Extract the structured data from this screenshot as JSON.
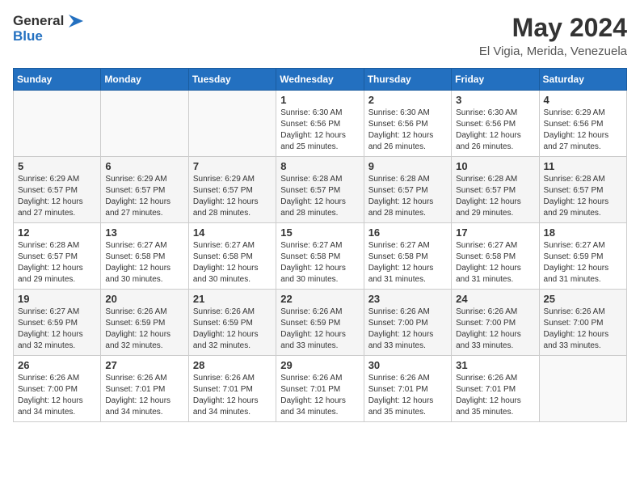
{
  "header": {
    "logo_line1": "General",
    "logo_line2": "Blue",
    "month_title": "May 2024",
    "subtitle": "El Vigia, Merida, Venezuela"
  },
  "days_of_week": [
    "Sunday",
    "Monday",
    "Tuesday",
    "Wednesday",
    "Thursday",
    "Friday",
    "Saturday"
  ],
  "weeks": [
    [
      {
        "num": "",
        "info": ""
      },
      {
        "num": "",
        "info": ""
      },
      {
        "num": "",
        "info": ""
      },
      {
        "num": "1",
        "info": "Sunrise: 6:30 AM\nSunset: 6:56 PM\nDaylight: 12 hours\nand 25 minutes."
      },
      {
        "num": "2",
        "info": "Sunrise: 6:30 AM\nSunset: 6:56 PM\nDaylight: 12 hours\nand 26 minutes."
      },
      {
        "num": "3",
        "info": "Sunrise: 6:30 AM\nSunset: 6:56 PM\nDaylight: 12 hours\nand 26 minutes."
      },
      {
        "num": "4",
        "info": "Sunrise: 6:29 AM\nSunset: 6:56 PM\nDaylight: 12 hours\nand 27 minutes."
      }
    ],
    [
      {
        "num": "5",
        "info": "Sunrise: 6:29 AM\nSunset: 6:57 PM\nDaylight: 12 hours\nand 27 minutes."
      },
      {
        "num": "6",
        "info": "Sunrise: 6:29 AM\nSunset: 6:57 PM\nDaylight: 12 hours\nand 27 minutes."
      },
      {
        "num": "7",
        "info": "Sunrise: 6:29 AM\nSunset: 6:57 PM\nDaylight: 12 hours\nand 28 minutes."
      },
      {
        "num": "8",
        "info": "Sunrise: 6:28 AM\nSunset: 6:57 PM\nDaylight: 12 hours\nand 28 minutes."
      },
      {
        "num": "9",
        "info": "Sunrise: 6:28 AM\nSunset: 6:57 PM\nDaylight: 12 hours\nand 28 minutes."
      },
      {
        "num": "10",
        "info": "Sunrise: 6:28 AM\nSunset: 6:57 PM\nDaylight: 12 hours\nand 29 minutes."
      },
      {
        "num": "11",
        "info": "Sunrise: 6:28 AM\nSunset: 6:57 PM\nDaylight: 12 hours\nand 29 minutes."
      }
    ],
    [
      {
        "num": "12",
        "info": "Sunrise: 6:28 AM\nSunset: 6:57 PM\nDaylight: 12 hours\nand 29 minutes."
      },
      {
        "num": "13",
        "info": "Sunrise: 6:27 AM\nSunset: 6:58 PM\nDaylight: 12 hours\nand 30 minutes."
      },
      {
        "num": "14",
        "info": "Sunrise: 6:27 AM\nSunset: 6:58 PM\nDaylight: 12 hours\nand 30 minutes."
      },
      {
        "num": "15",
        "info": "Sunrise: 6:27 AM\nSunset: 6:58 PM\nDaylight: 12 hours\nand 30 minutes."
      },
      {
        "num": "16",
        "info": "Sunrise: 6:27 AM\nSunset: 6:58 PM\nDaylight: 12 hours\nand 31 minutes."
      },
      {
        "num": "17",
        "info": "Sunrise: 6:27 AM\nSunset: 6:58 PM\nDaylight: 12 hours\nand 31 minutes."
      },
      {
        "num": "18",
        "info": "Sunrise: 6:27 AM\nSunset: 6:59 PM\nDaylight: 12 hours\nand 31 minutes."
      }
    ],
    [
      {
        "num": "19",
        "info": "Sunrise: 6:27 AM\nSunset: 6:59 PM\nDaylight: 12 hours\nand 32 minutes."
      },
      {
        "num": "20",
        "info": "Sunrise: 6:26 AM\nSunset: 6:59 PM\nDaylight: 12 hours\nand 32 minutes."
      },
      {
        "num": "21",
        "info": "Sunrise: 6:26 AM\nSunset: 6:59 PM\nDaylight: 12 hours\nand 32 minutes."
      },
      {
        "num": "22",
        "info": "Sunrise: 6:26 AM\nSunset: 6:59 PM\nDaylight: 12 hours\nand 33 minutes."
      },
      {
        "num": "23",
        "info": "Sunrise: 6:26 AM\nSunset: 7:00 PM\nDaylight: 12 hours\nand 33 minutes."
      },
      {
        "num": "24",
        "info": "Sunrise: 6:26 AM\nSunset: 7:00 PM\nDaylight: 12 hours\nand 33 minutes."
      },
      {
        "num": "25",
        "info": "Sunrise: 6:26 AM\nSunset: 7:00 PM\nDaylight: 12 hours\nand 33 minutes."
      }
    ],
    [
      {
        "num": "26",
        "info": "Sunrise: 6:26 AM\nSunset: 7:00 PM\nDaylight: 12 hours\nand 34 minutes."
      },
      {
        "num": "27",
        "info": "Sunrise: 6:26 AM\nSunset: 7:01 PM\nDaylight: 12 hours\nand 34 minutes."
      },
      {
        "num": "28",
        "info": "Sunrise: 6:26 AM\nSunset: 7:01 PM\nDaylight: 12 hours\nand 34 minutes."
      },
      {
        "num": "29",
        "info": "Sunrise: 6:26 AM\nSunset: 7:01 PM\nDaylight: 12 hours\nand 34 minutes."
      },
      {
        "num": "30",
        "info": "Sunrise: 6:26 AM\nSunset: 7:01 PM\nDaylight: 12 hours\nand 35 minutes."
      },
      {
        "num": "31",
        "info": "Sunrise: 6:26 AM\nSunset: 7:01 PM\nDaylight: 12 hours\nand 35 minutes."
      },
      {
        "num": "",
        "info": ""
      }
    ]
  ]
}
